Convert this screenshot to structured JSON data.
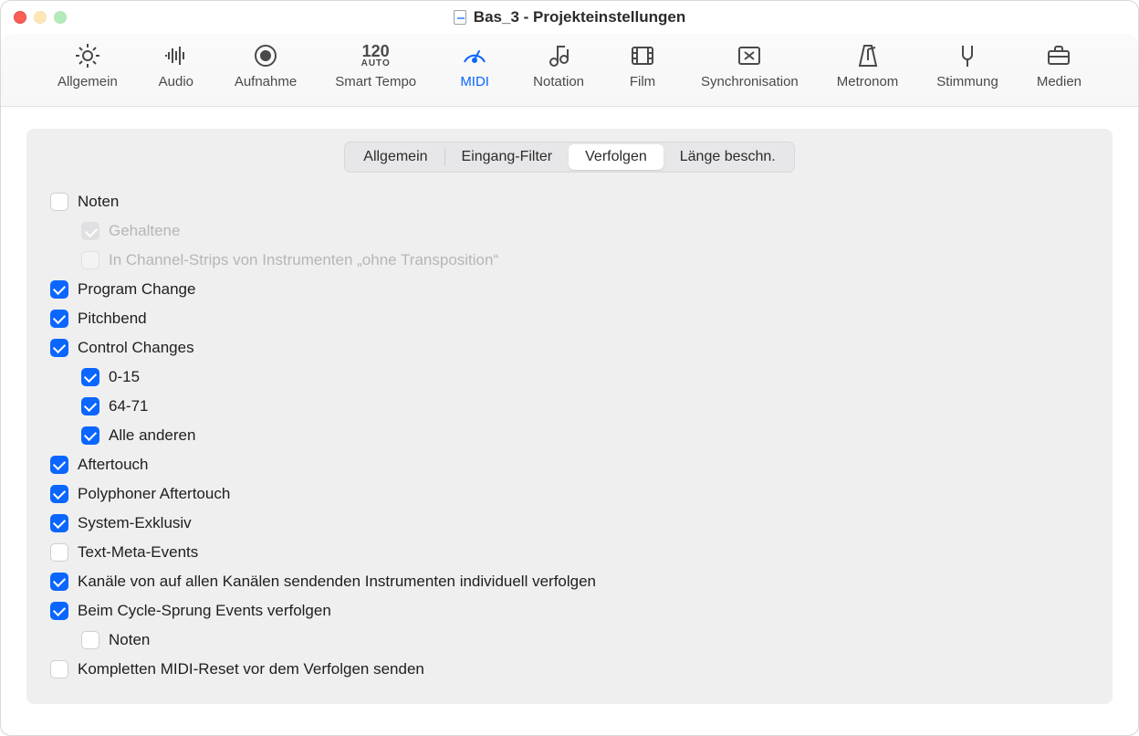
{
  "window": {
    "title": "Bas_3 - Projekteinstellungen"
  },
  "toolbar": {
    "allgemein": "Allgemein",
    "audio": "Audio",
    "aufnahme": "Aufnahme",
    "smart_tempo": "Smart Tempo",
    "smart_tempo_value": "120",
    "smart_tempo_sub": "AUTO",
    "midi": "MIDI",
    "notation": "Notation",
    "film": "Film",
    "synchronisation": "Synchronisation",
    "metronom": "Metronom",
    "stimmung": "Stimmung",
    "medien": "Medien"
  },
  "segmented": {
    "allgemein": "Allgemein",
    "eingang_filter": "Eingang-Filter",
    "verfolgen": "Verfolgen",
    "laenge_beschn": "Länge beschn."
  },
  "items": {
    "noten": "Noten",
    "gehaltene": "Gehaltene",
    "in_channel_strips": "In Channel-Strips von Instrumenten „ohne Transposition“",
    "program_change": "Program Change",
    "pitchbend": "Pitchbend",
    "control_changes": "Control Changes",
    "cc_0_15": "0-15",
    "cc_64_71": "64-71",
    "cc_alle": "Alle anderen",
    "aftertouch": "Aftertouch",
    "poly_aftertouch": "Polyphoner Aftertouch",
    "sysex": "System-Exklusiv",
    "text_meta": "Text-Meta-Events",
    "kanaele_verfolgen": "Kanäle von auf allen Kanälen sendenden Instrumenten individuell verfolgen",
    "cycle_sprung": "Beim Cycle-Sprung Events verfolgen",
    "cycle_noten": "Noten",
    "midi_reset": "Kompletten MIDI-Reset vor dem Verfolgen senden"
  }
}
